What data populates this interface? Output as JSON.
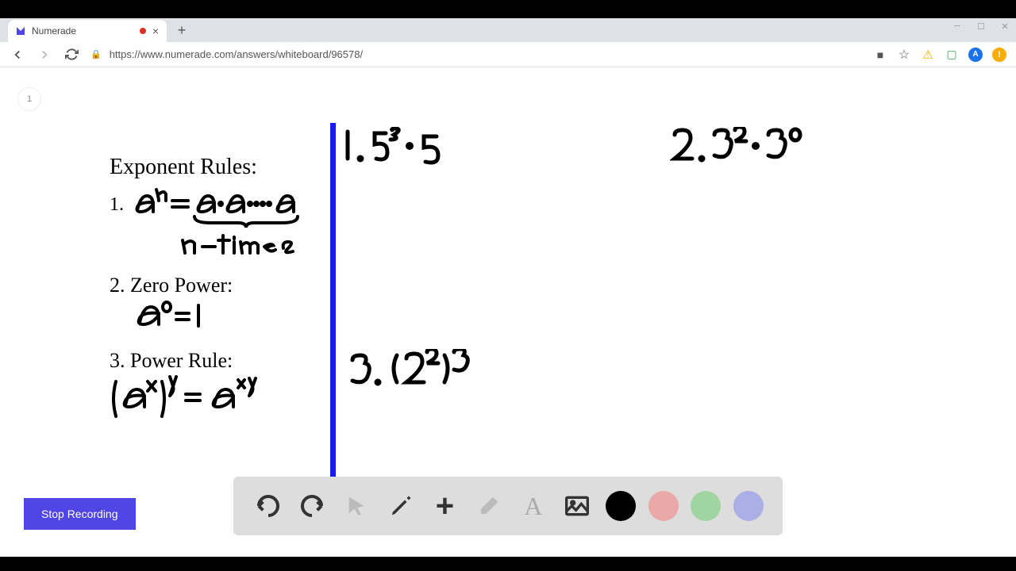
{
  "tab": {
    "title": "Numerade",
    "recording": true
  },
  "url": "https://www.numerade.com/answers/whiteboard/96578/",
  "page_number": "1",
  "typed_text": {
    "heading": "Exponent Rules:",
    "rule1_label": "1.",
    "rule2_label": "2. Zero Power:",
    "rule3_label": "3. Power Rule:"
  },
  "handwritten": {
    "rule1_eq": "aⁿ = a·a·...·a",
    "rule1_under": "n-times",
    "rule2_eq": "a⁰ = 1",
    "rule3_eq": "(aˣ)ʸ = aˣʸ",
    "prob1": "1. 5³ · 5",
    "prob2": "2. 3² · 3⁰",
    "prob3": "3. (2²)³"
  },
  "button": {
    "stop": "Stop Recording"
  },
  "toolbar": {
    "undo": "↶",
    "redo": "↷",
    "pointer": "➤",
    "pen": "✎",
    "add": "+",
    "erase": "⌫",
    "text": "A",
    "image": "🖼"
  },
  "colors": {
    "black": "#000000",
    "pink": "#eba8a8",
    "green": "#a0d4a0",
    "blue": "#aab0e5"
  }
}
